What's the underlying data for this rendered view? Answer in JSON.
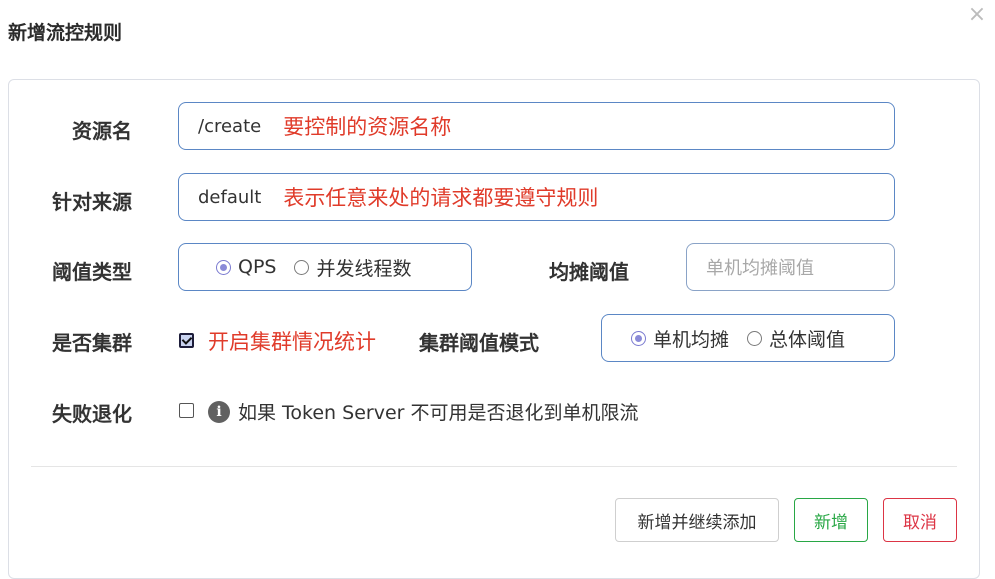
{
  "dialog": {
    "title": "新增流控规则",
    "close_symbol": "×"
  },
  "form": {
    "resource": {
      "label": "资源名",
      "value": "/create",
      "annotation": "要控制的资源名称"
    },
    "limit_app": {
      "label": "针对来源",
      "value": "default",
      "annotation": "表示任意来处的请求都要遵守规则"
    },
    "grade": {
      "label": "阈值类型",
      "options": [
        {
          "label": "QPS",
          "checked": true
        },
        {
          "label": "并发线程数",
          "checked": false
        }
      ]
    },
    "shared_threshold": {
      "label": "均摊阈值",
      "placeholder": "单机均摊阈值"
    },
    "cluster": {
      "label": "是否集群",
      "checked": true,
      "annotation": "开启集群情况统计"
    },
    "cluster_threshold_mode": {
      "label": "集群阈值模式",
      "options": [
        {
          "label": "单机均摊",
          "checked": true
        },
        {
          "label": "总体阈值",
          "checked": false
        }
      ]
    },
    "fallback": {
      "label": "失败退化",
      "checked": false,
      "info_icon": "i",
      "text": "如果 Token Server 不可用是否退化到单机限流"
    }
  },
  "buttons": {
    "add_continue": "新增并继续添加",
    "add": "新增",
    "cancel": "取消"
  },
  "colors": {
    "add_button": "#28a745",
    "cancel_button": "#dc3545",
    "annotation": "#e03b2a",
    "input_border": "#5b87c5"
  }
}
